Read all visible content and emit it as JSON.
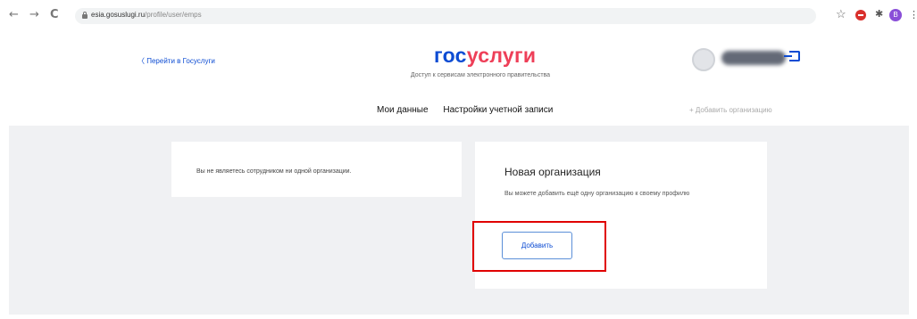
{
  "browser": {
    "back": "←",
    "forward": "→",
    "reload": "C",
    "url_host": "esia.gosuslugi.ru",
    "url_path": "/profile/user/emps",
    "star": "☆",
    "puzzle": "✱",
    "avatar_letter": "B",
    "menu": "⋮"
  },
  "header": {
    "back_link": "〈  Перейти в Госуслуги",
    "logo_part1": "гос",
    "logo_part2": "услуги",
    "tagline": "Доступ к сервисам электронного правительства",
    "brand_colors": {
      "blue": "#0d4cd3",
      "red": "#ee3f58"
    }
  },
  "nav": {
    "tabs": [
      "Мои данные",
      "Настройки учетной записи"
    ],
    "add_org": "+ Добавить организацию"
  },
  "cards": {
    "left_text": "Вы не являетесь сотрудником ни одной организации.",
    "right_title": "Новая организация",
    "right_desc": "Вы можете добавить ещё одну организацию к своему профилю",
    "add_button": "Добавить"
  },
  "icons": [
    "lock-icon",
    "star-icon",
    "extension-icon",
    "puzzle-icon",
    "profile-icon",
    "menu-icon",
    "logout-icon",
    "user-avatar"
  ],
  "highlight_color": "#e00000"
}
